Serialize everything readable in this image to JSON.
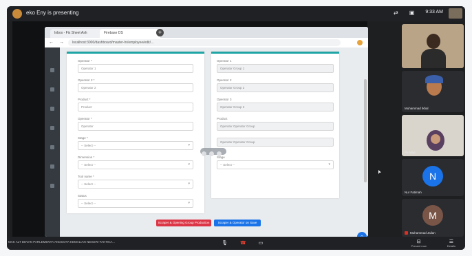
{
  "meeting": {
    "presenter_text": "eko Eny is presenting",
    "time": "9:33 AM",
    "meeting_info": "MAK ALT DEVAN PARLEMENTA ANGGOTA KEMALIAN NEGERI-FAKTIKA...",
    "controls": {
      "mic": "🎙",
      "end": "☎",
      "camera": "▭"
    },
    "right_controls": [
      {
        "icon": "⊟",
        "label": "Present now"
      },
      {
        "icon": "☰",
        "label": "Details"
      }
    ]
  },
  "browser": {
    "tabs": [
      "Inbox - Fix Sheet Ash",
      "Firebase DS"
    ],
    "new_tab": "+",
    "nav": "← → ⟳",
    "url": "localhost:3000/dashboard/master-hr/employee/edit/..."
  },
  "form_left": {
    "fields": [
      {
        "label": "Operator *",
        "value": "Operator 1"
      },
      {
        "label": "Operator 2 *",
        "value": "Operator 2"
      },
      {
        "label": "Product *",
        "value": "Product"
      },
      {
        "label": "Operator *",
        "value": "Operator"
      },
      {
        "label": "Stage *",
        "value": "-- Select --"
      },
      {
        "label": "Dimension *",
        "value": "-- Select --"
      },
      {
        "label": "Tool name *",
        "value": "-- Select --"
      },
      {
        "label": "Status",
        "value": "-- Select --"
      }
    ]
  },
  "form_right": {
    "fields": [
      {
        "label": "Operator 1",
        "value": "Operator Group 1"
      },
      {
        "label": "Operator 2",
        "value": "Operator Group 2"
      },
      {
        "label": "Operator 3",
        "value": "Operator Group 3"
      },
      {
        "label": "Product",
        "value": "Operator Operator Group"
      },
      {
        "label": "",
        "value": "Operator Operator Group"
      },
      {
        "label": "Stage",
        "value": "-- Select --"
      }
    ]
  },
  "buttons": {
    "danger": "Scraper & Opening Group Production",
    "primary": "Scraper & Operator on Save"
  },
  "participants": [
    {
      "name": "",
      "initial": ""
    },
    {
      "name": "Muhammad Ikbal",
      "initial": ""
    },
    {
      "name": "Pu Mao",
      "initial": ""
    },
    {
      "name": "Nur Fatimah",
      "initial": "N"
    },
    {
      "name": "Muhammad Jailan",
      "initial": "M"
    }
  ],
  "colors": {
    "teal": "#1fa5a5",
    "danger": "#dc3545",
    "primary": "#1a73e8",
    "meet_bg": "#202124"
  }
}
